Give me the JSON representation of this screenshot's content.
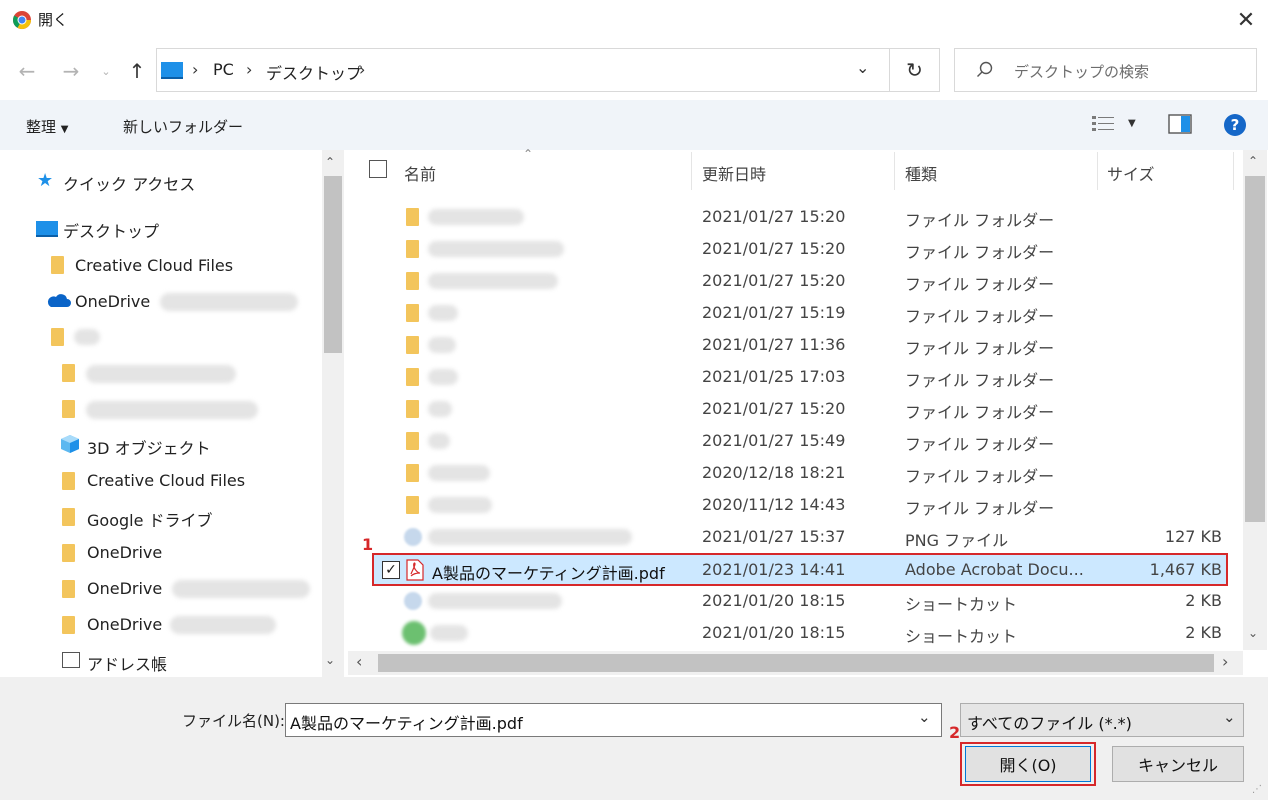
{
  "window": {
    "title": "開く"
  },
  "nav": {
    "breadcrumbs": [
      "PC",
      "デスクトップ"
    ],
    "search_placeholder": "デスクトップの検索"
  },
  "toolbar": {
    "organize": "整理",
    "new_folder": "新しいフォルダー"
  },
  "sidebar": {
    "quick_access": "クイック アクセス",
    "desktop": "デスクトップ",
    "creative_cloud_1": "Creative Cloud Files",
    "onedrive_1": "OneDrive",
    "objects_3d": "3D オブジェクト",
    "creative_cloud_2": "Creative Cloud Files",
    "google_drive": "Google ドライブ",
    "onedrive_2": "OneDrive",
    "onedrive_3": "OneDrive",
    "onedrive_4": "OneDrive",
    "address_book": "アドレス帳"
  },
  "columns": {
    "name": "名前",
    "date": "更新日時",
    "type": "種類",
    "size": "サイズ"
  },
  "rows": [
    {
      "date": "2021/01/27 15:20",
      "type": "ファイル フォルダー",
      "size": ""
    },
    {
      "date": "2021/01/27 15:20",
      "type": "ファイル フォルダー",
      "size": ""
    },
    {
      "date": "2021/01/27 15:20",
      "type": "ファイル フォルダー",
      "size": ""
    },
    {
      "date": "2021/01/27 15:19",
      "type": "ファイル フォルダー",
      "size": ""
    },
    {
      "date": "2021/01/27 11:36",
      "type": "ファイル フォルダー",
      "size": ""
    },
    {
      "date": "2021/01/25 17:03",
      "type": "ファイル フォルダー",
      "size": ""
    },
    {
      "date": "2021/01/27 15:20",
      "type": "ファイル フォルダー",
      "size": ""
    },
    {
      "date": "2021/01/27 15:49",
      "type": "ファイル フォルダー",
      "size": ""
    },
    {
      "date": "2020/12/18 18:21",
      "type": "ファイル フォルダー",
      "size": ""
    },
    {
      "date": "2020/11/12 14:43",
      "type": "ファイル フォルダー",
      "size": ""
    },
    {
      "date": "2021/01/27 15:37",
      "type": "PNG ファイル",
      "size": "127 KB"
    },
    {
      "name": "A製品のマーケティング計画.pdf",
      "date": "2021/01/23 14:41",
      "type": "Adobe Acrobat Docu...",
      "size": "1,467 KB"
    },
    {
      "date": "2021/01/20 18:15",
      "type": "ショートカット",
      "size": "2 KB"
    },
    {
      "date": "2021/01/20 18:15",
      "type": "ショートカット",
      "size": "2 KB"
    }
  ],
  "annotations": {
    "step1": "1",
    "step2": "2"
  },
  "footer": {
    "filename_label": "ファイル名(N):",
    "filename_value": "A製品のマーケティング計画.pdf",
    "filter": "すべてのファイル (*.*)",
    "open_button": "開く(O)",
    "cancel_button": "キャンセル"
  },
  "colors": {
    "selected_row": "#cce8ff",
    "highlight": "#d6282a",
    "folder": "#f3c55c"
  }
}
